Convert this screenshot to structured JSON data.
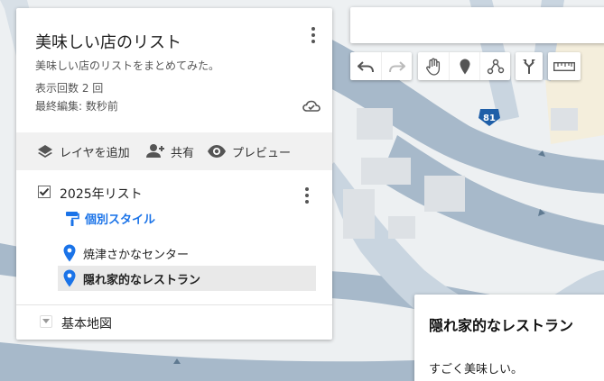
{
  "map": {
    "route_badge": "81",
    "colors": {
      "road": "#a7b9ca",
      "road_light": "#c9d5e0",
      "land": "#edf0f2",
      "building": "#dde1e5",
      "park": "#f6ecd3"
    }
  },
  "panel": {
    "title": "美味しい店のリスト",
    "description": "美味しい店のリストをまとめてみた。",
    "views": "表示回数 2 回",
    "last_edited": "最終編集: 数秒前",
    "toolbar": {
      "add_layer": "レイヤを追加",
      "share": "共有",
      "preview": "プレビュー"
    },
    "layer": {
      "name": "2025年リスト",
      "checked": true,
      "style_link": "個別スタイル",
      "places": [
        {
          "label": "焼津さかなセンター",
          "selected": false
        },
        {
          "label": "隠れ家的なレストラン",
          "selected": true
        }
      ]
    },
    "base_map": "基本地図"
  },
  "search": {
    "placeholder": ""
  },
  "tools": [
    "undo-icon",
    "redo-icon",
    "hand-icon",
    "marker-icon",
    "line-icon",
    "directions-icon",
    "ruler-icon"
  ],
  "accent_color": "#1a73e8",
  "info_card": {
    "title": "隠れ家的なレストラン",
    "description": "すごく美味しい。"
  }
}
